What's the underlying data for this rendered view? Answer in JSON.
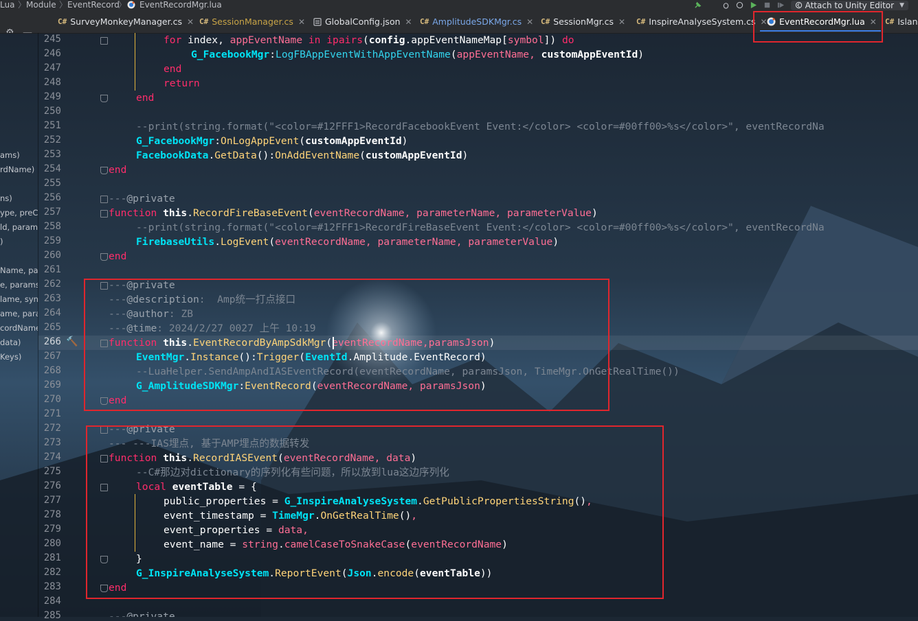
{
  "breadcrumb": [
    "Lua",
    "Module",
    "EventRecord",
    "EventRecordMgr.lua"
  ],
  "toolbar": {
    "attach_label": "Attach to Unity Editor"
  },
  "tabs": [
    {
      "prefix": "C#",
      "label": "SurveyMonkeyManager.cs",
      "state": "normal"
    },
    {
      "prefix": "C#",
      "label": "SessionManager.cs",
      "state": "modified"
    },
    {
      "prefix": "",
      "label": "GlobalConfig.json",
      "state": "normal"
    },
    {
      "prefix": "C#",
      "label": "AmplitudeSDKMgr.cs",
      "state": "vcs"
    },
    {
      "prefix": "C#",
      "label": "SessionMgr.cs",
      "state": "normal"
    },
    {
      "prefix": "C#",
      "label": "InspireAnalyseSystem.cs",
      "state": "normal"
    },
    {
      "prefix": "",
      "label": "EventRecordMgr.lua",
      "state": "active"
    },
    {
      "prefix": "C#",
      "label": "Islan",
      "state": "normal"
    }
  ],
  "left_panel": [
    {
      "text": "ams)",
      "line": 253
    },
    {
      "text": "rdName)",
      "line": 254
    },
    {
      "text": "ns)",
      "line": 256
    },
    {
      "text": "ype, preC",
      "line": 257
    },
    {
      "text": "ld, param",
      "line": 258
    },
    {
      "text": ")",
      "line": 259
    },
    {
      "text": "Name, par",
      "line": 261
    },
    {
      "text": "e, params",
      "line": 262
    },
    {
      "text": "lame, syn",
      "line": 263
    },
    {
      "text": "ame, para",
      "line": 264
    },
    {
      "text": "cordName",
      "line": 265
    },
    {
      "text": "data)",
      "line": 266
    },
    {
      "text": "Keys)",
      "line": 267
    }
  ],
  "editor": {
    "first_line": 245,
    "current_line": 266,
    "code_lines": [
      {
        "n": 245,
        "indent": 2,
        "t": [
          [
            "kw",
            "for "
          ],
          [
            "id",
            "index"
          ],
          [
            "id",
            ", "
          ],
          [
            "prm",
            "appEventName"
          ],
          [
            "kw",
            " in "
          ],
          [
            "fnk",
            "ipairs"
          ],
          [
            "id",
            "("
          ],
          [
            "pr",
            "config"
          ],
          [
            "id",
            "."
          ],
          [
            "id",
            "appEventNameMap"
          ],
          [
            "id",
            "["
          ],
          [
            "prm",
            "symbol"
          ],
          [
            "id",
            "]) "
          ],
          [
            "kw",
            "do"
          ]
        ]
      },
      {
        "n": 246,
        "indent": 3,
        "t": [
          [
            "obj",
            "G_FacebookMgr"
          ],
          [
            "id",
            ":"
          ],
          [
            "cls",
            "LogFBAppEventWithAppEventName"
          ],
          [
            "id",
            "("
          ],
          [
            "prm",
            "appEventName"
          ],
          [
            "prm",
            ", "
          ],
          [
            "pr",
            "customAppEventId"
          ],
          [
            "id",
            ")"
          ]
        ]
      },
      {
        "n": 247,
        "indent": 2,
        "t": [
          [
            "kw",
            "end"
          ]
        ]
      },
      {
        "n": 248,
        "indent": 2,
        "t": [
          [
            "kw",
            "return"
          ]
        ]
      },
      {
        "n": 249,
        "indent": 1,
        "t": [
          [
            "kw",
            "end"
          ]
        ]
      },
      {
        "n": 250,
        "indent": 0,
        "t": []
      },
      {
        "n": 251,
        "indent": 1,
        "t": [
          [
            "cm",
            "--print(string.format(\"<color=#12FFF1>RecordFacebookEvent Event:</color> <color=#00ff00>%s</color>\", eventRecordNa"
          ]
        ]
      },
      {
        "n": 252,
        "indent": 1,
        "t": [
          [
            "obj",
            "G_FacebookMgr"
          ],
          [
            "id",
            ":"
          ],
          [
            "fn",
            "OnLogAppEvent"
          ],
          [
            "id",
            "("
          ],
          [
            "pr",
            "customAppEventId"
          ],
          [
            "id",
            ")"
          ]
        ]
      },
      {
        "n": 253,
        "indent": 1,
        "t": [
          [
            "obj",
            "FacebookData"
          ],
          [
            "id",
            "."
          ],
          [
            "fn",
            "GetData"
          ],
          [
            "id",
            "():"
          ],
          [
            "fn",
            "OnAddEventName"
          ],
          [
            "id",
            "("
          ],
          [
            "pr",
            "customAppEventId"
          ],
          [
            "id",
            ")"
          ]
        ]
      },
      {
        "n": 254,
        "indent": 0,
        "t": [
          [
            "kw",
            "end"
          ]
        ]
      },
      {
        "n": 255,
        "indent": 0,
        "t": []
      },
      {
        "n": 256,
        "indent": 0,
        "t": [
          [
            "cm",
            "---"
          ],
          [
            "ca",
            "@private"
          ]
        ]
      },
      {
        "n": 257,
        "indent": 0,
        "t": [
          [
            "fnk",
            "function "
          ],
          [
            "th",
            "this"
          ],
          [
            "id",
            "."
          ],
          [
            "fn",
            "RecordFireBaseEvent"
          ],
          [
            "id",
            "("
          ],
          [
            "prm",
            "eventRecordName"
          ],
          [
            "prm",
            ", "
          ],
          [
            "prm",
            "parameterName"
          ],
          [
            "prm",
            ", "
          ],
          [
            "prm",
            "parameterValue"
          ],
          [
            "id",
            ")"
          ]
        ]
      },
      {
        "n": 258,
        "indent": 1,
        "t": [
          [
            "cm",
            "--print(string.format(\"<color=#12FFF1>RecordFireBaseEvent Event:</color> <color=#00ff00>%s</color>\", eventRecordNa"
          ]
        ]
      },
      {
        "n": 259,
        "indent": 1,
        "t": [
          [
            "obj",
            "FirebaseUtils"
          ],
          [
            "id",
            "."
          ],
          [
            "fn",
            "LogEvent"
          ],
          [
            "id",
            "("
          ],
          [
            "prm",
            "eventRecordName"
          ],
          [
            "prm",
            ", "
          ],
          [
            "prm",
            "parameterName"
          ],
          [
            "prm",
            ", "
          ],
          [
            "prm",
            "parameterValue"
          ],
          [
            "id",
            ")"
          ]
        ]
      },
      {
        "n": 260,
        "indent": 0,
        "t": [
          [
            "kw",
            "end"
          ]
        ]
      },
      {
        "n": 261,
        "indent": 0,
        "t": []
      },
      {
        "n": 262,
        "indent": 0,
        "t": [
          [
            "cm",
            "---"
          ],
          [
            "ca",
            "@private"
          ]
        ]
      },
      {
        "n": 263,
        "indent": 0,
        "t": [
          [
            "cm",
            "---"
          ],
          [
            "ca",
            "@description"
          ],
          [
            "cm",
            ":  Amp统一打点接口"
          ]
        ]
      },
      {
        "n": 264,
        "indent": 0,
        "t": [
          [
            "cm",
            "---"
          ],
          [
            "ca",
            "@author"
          ],
          [
            "cm",
            ": ZB"
          ]
        ]
      },
      {
        "n": 265,
        "indent": 0,
        "t": [
          [
            "cm",
            "---"
          ],
          [
            "ca",
            "@time"
          ],
          [
            "cm",
            ": 2024/2/27 0027 上午 10:19"
          ]
        ]
      },
      {
        "n": 266,
        "indent": 0,
        "t": [
          [
            "fnk",
            "function "
          ],
          [
            "th",
            "this"
          ],
          [
            "id",
            "."
          ],
          [
            "fn",
            "EventRecordByAmpSdkMgr"
          ],
          [
            "id",
            "("
          ],
          [
            "prm",
            "eventRecordName"
          ],
          [
            "prm",
            ","
          ],
          [
            "prm",
            "paramsJson"
          ],
          [
            "id",
            ")"
          ]
        ]
      },
      {
        "n": 267,
        "indent": 1,
        "t": [
          [
            "obj",
            "EventMgr"
          ],
          [
            "id",
            "."
          ],
          [
            "fn",
            "Instance"
          ],
          [
            "id",
            "():"
          ],
          [
            "fn",
            "Trigger"
          ],
          [
            "id",
            "("
          ],
          [
            "obj",
            "EventId"
          ],
          [
            "id",
            "."
          ],
          [
            "id",
            "Amplitude"
          ],
          [
            "id",
            "."
          ],
          [
            "id",
            "EventRecord"
          ],
          [
            "id",
            ")"
          ]
        ]
      },
      {
        "n": 268,
        "indent": 1,
        "t": [
          [
            "cm",
            "--LuaHelper.SendAmpAndIASEventRecord(eventRecordName, paramsJson, TimeMgr.OnGetRealTime())"
          ]
        ]
      },
      {
        "n": 269,
        "indent": 1,
        "t": [
          [
            "obj",
            "G_AmplitudeSDKMgr"
          ],
          [
            "id",
            ":"
          ],
          [
            "fn",
            "EventRecord"
          ],
          [
            "id",
            "("
          ],
          [
            "prm",
            "eventRecordName"
          ],
          [
            "prm",
            ", "
          ],
          [
            "prm",
            "paramsJson"
          ],
          [
            "id",
            ")"
          ]
        ]
      },
      {
        "n": 270,
        "indent": 0,
        "t": [
          [
            "kw",
            "end"
          ]
        ]
      },
      {
        "n": 271,
        "indent": 0,
        "t": []
      },
      {
        "n": 272,
        "indent": 0,
        "t": [
          [
            "cm",
            "---"
          ],
          [
            "ca",
            "@private"
          ]
        ]
      },
      {
        "n": 273,
        "indent": 0,
        "t": [
          [
            "cm",
            "--- ---IAS埋点, 基于AMP埋点的数据转发"
          ]
        ]
      },
      {
        "n": 274,
        "indent": 0,
        "t": [
          [
            "fnk",
            "function "
          ],
          [
            "th",
            "this"
          ],
          [
            "id",
            "."
          ],
          [
            "fn",
            "RecordIASEvent"
          ],
          [
            "id",
            "("
          ],
          [
            "prm",
            "eventRecordName"
          ],
          [
            "prm",
            ", "
          ],
          [
            "prm",
            "data"
          ],
          [
            "id",
            ")"
          ]
        ]
      },
      {
        "n": 275,
        "indent": 1,
        "t": [
          [
            "cm",
            "--C#那边对dictionary的序列化有些问题，所以放到lua这边序列化"
          ]
        ]
      },
      {
        "n": 276,
        "indent": 1,
        "t": [
          [
            "kw",
            "local "
          ],
          [
            "pr",
            "eventTable"
          ],
          [
            "id",
            " = {"
          ]
        ]
      },
      {
        "n": 277,
        "indent": 2,
        "t": [
          [
            "id",
            "public_properties = "
          ],
          [
            "obj",
            "G_InspireAnalyseSystem"
          ],
          [
            "id",
            "."
          ],
          [
            "fn",
            "GetPublicPropertiesString"
          ],
          [
            "id",
            "()"
          ],
          [
            "prm",
            ","
          ]
        ]
      },
      {
        "n": 278,
        "indent": 2,
        "t": [
          [
            "id",
            "event_timestamp = "
          ],
          [
            "obj",
            "TimeMgr"
          ],
          [
            "id",
            "."
          ],
          [
            "fn",
            "OnGetRealTime"
          ],
          [
            "id",
            "()"
          ],
          [
            "prm",
            ","
          ]
        ]
      },
      {
        "n": 279,
        "indent": 2,
        "t": [
          [
            "id",
            "event_properties = "
          ],
          [
            "prm",
            "data"
          ],
          [
            "prm",
            ","
          ]
        ]
      },
      {
        "n": 280,
        "indent": 2,
        "t": [
          [
            "id",
            "event_name = "
          ],
          [
            "str",
            "string"
          ],
          [
            "id",
            "."
          ],
          [
            "str",
            "camelCaseToSnakeCase"
          ],
          [
            "id",
            "("
          ],
          [
            "prm",
            "eventRecordName"
          ],
          [
            "id",
            ")"
          ]
        ]
      },
      {
        "n": 281,
        "indent": 1,
        "t": [
          [
            "id",
            "}"
          ]
        ]
      },
      {
        "n": 282,
        "indent": 1,
        "t": [
          [
            "obj",
            "G_InspireAnalyseSystem"
          ],
          [
            "id",
            "."
          ],
          [
            "fn",
            "ReportEvent"
          ],
          [
            "id",
            "("
          ],
          [
            "obj",
            "Json"
          ],
          [
            "id",
            "."
          ],
          [
            "fn",
            "encode"
          ],
          [
            "id",
            "("
          ],
          [
            "pr",
            "eventTable"
          ],
          [
            "id",
            "))"
          ]
        ]
      },
      {
        "n": 283,
        "indent": 0,
        "t": [
          [
            "kw",
            "end"
          ]
        ]
      },
      {
        "n": 284,
        "indent": 0,
        "t": []
      },
      {
        "n": 285,
        "indent": 0,
        "t": [
          [
            "cm",
            "---"
          ],
          [
            "ca",
            "@private"
          ]
        ]
      }
    ]
  },
  "colors": {
    "highlight_box": "#e0262d",
    "tab_underline": "#3d7ee6",
    "indent_guide": "#e2b33c"
  }
}
